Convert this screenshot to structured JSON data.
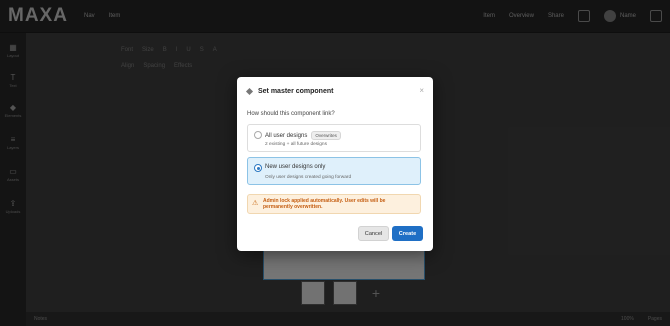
{
  "app": {
    "logo": "MAXA",
    "nav": [
      "Nav",
      "Item"
    ],
    "right_nav": [
      "Item",
      "Overview",
      "Share"
    ],
    "user": "Name"
  },
  "leftbar": {
    "tools": [
      "Layout",
      "Text",
      "Elements",
      "Layers",
      "Assets",
      "Uploads"
    ]
  },
  "canvas": {
    "toolbar_row1": [
      "Font",
      "Size",
      "B",
      "I",
      "U",
      "S",
      "A"
    ],
    "toolbar_row2": [
      "Align",
      "Spacing",
      "Effects"
    ]
  },
  "bottombar": {
    "left": "Notes",
    "zoom": "100%",
    "right": "Pages"
  },
  "modal": {
    "title": "Set master component",
    "close_icon": "close-icon",
    "question": "How should this component link?",
    "options": [
      {
        "label": "All user designs",
        "badge": "Overwrites",
        "description": "2 existing + all future designs",
        "selected": false
      },
      {
        "label": "New user designs only",
        "badge": "",
        "description": "Only user designs created going forward",
        "selected": true
      }
    ],
    "warning": "Admin lock applied automatically. User edits will be permanently overwritten.",
    "cancel_label": "Cancel",
    "create_label": "Create"
  },
  "colors": {
    "primary": "#1f6fc5",
    "selected_bg": "#dff0fb",
    "warning_bg": "#fdf0de",
    "warning_text": "#c55e12"
  }
}
